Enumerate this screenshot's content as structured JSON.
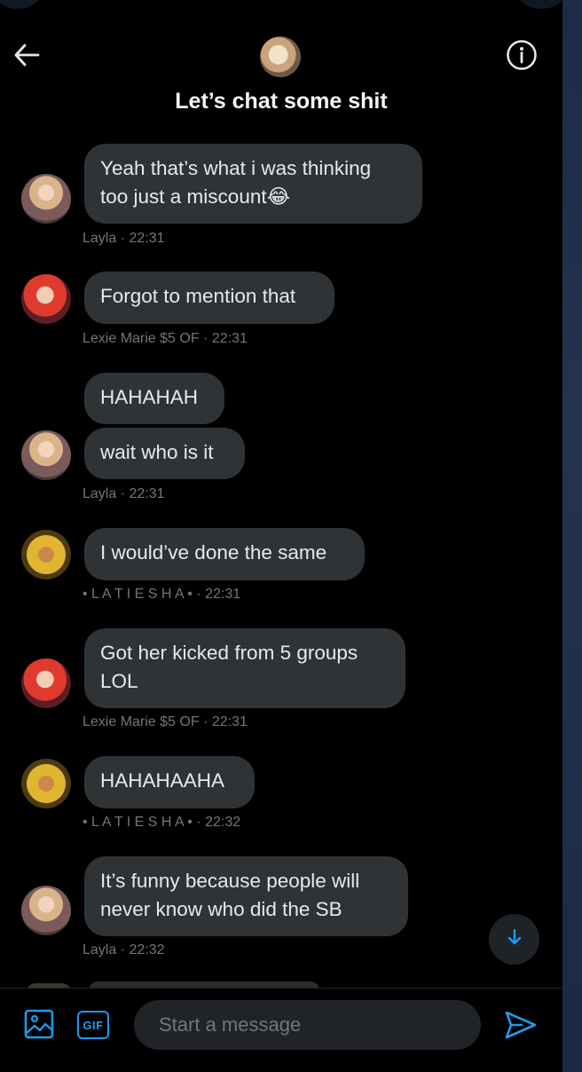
{
  "header": {
    "title": "Let’s chat some shit",
    "back_icon": "arrow-left-icon",
    "info_icon": "info-icon"
  },
  "messages": [
    {
      "sender": "Layla",
      "texts": [
        "Yeah that’s what i was thinking\ntoo just a miscount😂"
      ],
      "meta": "Layla · 22:31"
    },
    {
      "sender": "Lexie Marie $5 OF",
      "texts": [
        "Forgot to mention that"
      ],
      "meta": "Lexie Marie $5 OF · 22:31"
    },
    {
      "sender": "Layla",
      "texts": [
        "HAHAHAH",
        "wait who is it"
      ],
      "meta": "Layla · 22:31"
    },
    {
      "sender": "•LATIESHA•",
      "texts": [
        "I would’ve done the same"
      ],
      "meta": "• L A T I E S H A • · 22:31"
    },
    {
      "sender": "Lexie Marie $5 OF",
      "texts": [
        "Got her kicked from 5 groups\nLOL"
      ],
      "meta": "Lexie Marie $5 OF · 22:31"
    },
    {
      "sender": "•LATIESHA•",
      "texts": [
        "HAHAHAAHA"
      ],
      "meta": "• L A T I E S H A • · 22:32"
    },
    {
      "sender": "Layla",
      "texts": [
        "It’s funny because people will\nnever know who did the SB"
      ],
      "meta": "Layla · 22:32"
    }
  ],
  "composer": {
    "placeholder": "Start a message",
    "gif_label": "GIF",
    "media_icon": "image-icon",
    "send_icon": "send-icon"
  },
  "scroll_down_icon": "arrow-down-icon",
  "colors": {
    "background": "#000000",
    "bubble": "#2f3336",
    "accent": "#1d9bf0",
    "meta_text": "#71767b"
  }
}
